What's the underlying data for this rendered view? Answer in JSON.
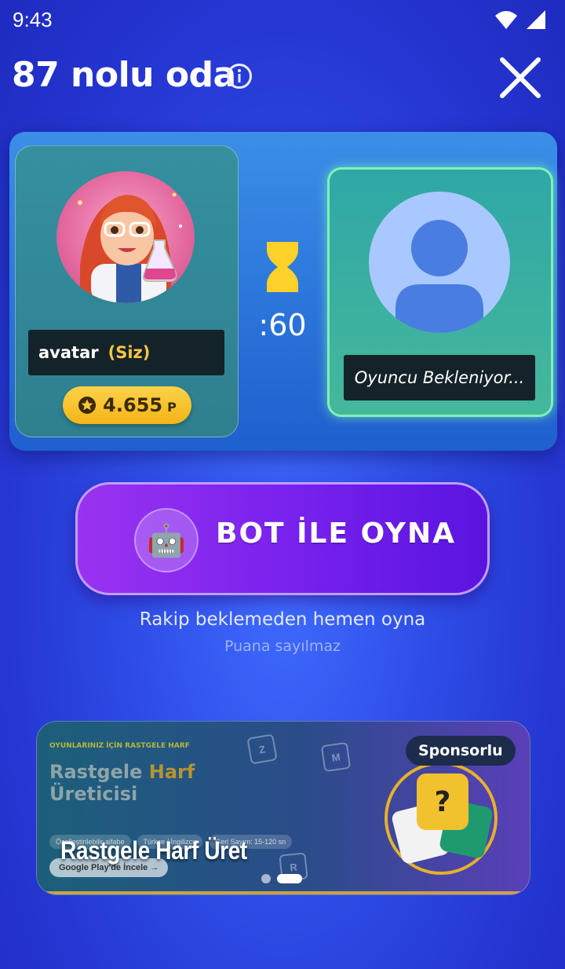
{
  "status_bar": {
    "time": "9:43"
  },
  "header": {
    "room_title": "87 nolu oda"
  },
  "player": {
    "name": "avatar",
    "you_label": "(Siz)",
    "points": "4.655",
    "points_unit": "P"
  },
  "timer": {
    "label": ":60"
  },
  "opponent": {
    "status": "Oyuncu Bekleniyor..."
  },
  "bot_play": {
    "label": "BOT İLE OYNA",
    "subtitle": "Rakip beklemeden hemen oyna",
    "note": "Puana sayılmaz"
  },
  "ad": {
    "eyebrow": "OYUNLARINIZ İÇİN RASTGELE HARF",
    "title_line1_a": "Rastgele ",
    "title_line1_b": "Harf",
    "title_line2": "Üreticisi",
    "chips": [
      "Özelleştirilebilir alfabe",
      "Türkçe / İngilizce",
      "Geri Sayım: 15-120 sn"
    ],
    "play_label": "Google Play'de İncele →",
    "caption": "Rastgele Harf Üret",
    "sponsor_label": "Sponsorlu",
    "tiles": [
      "Z",
      "M",
      "R"
    ],
    "art_symbol": "?",
    "slides": 2,
    "active_slide": 2
  },
  "colors": {
    "accent_gold": "#f8c543",
    "opponent_glow": "#7ef2b4",
    "bot_button": "#7a22ee"
  }
}
